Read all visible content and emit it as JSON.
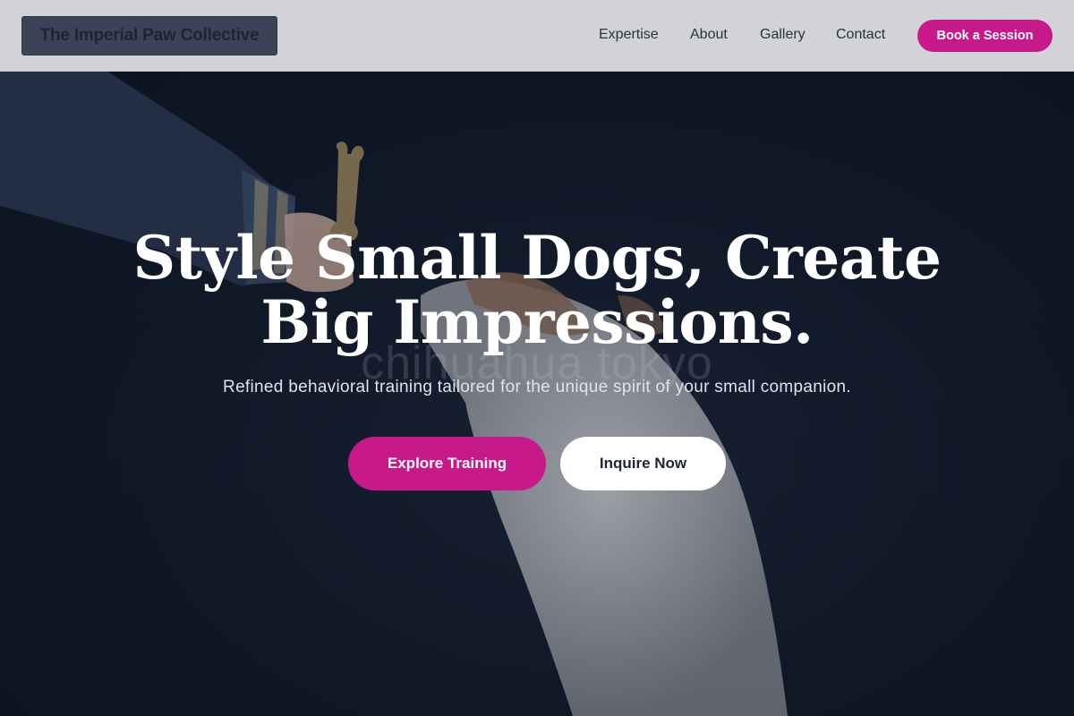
{
  "brand": {
    "name": "The Imperial Paw Collective"
  },
  "nav": {
    "links": [
      "Expertise",
      "About",
      "Gallery",
      "Contact"
    ],
    "cta": "Book a Session"
  },
  "hero": {
    "headline_line1": "Style Small Dogs, Create",
    "headline_line2": "Big Impressions.",
    "watermark": "chihuahua tokyo",
    "subheadline": "Refined behavioral training tailored for the unique spirit of your small companion.",
    "primary_button": "Explore Training",
    "secondary_button": "Inquire Now"
  },
  "colors": {
    "accent": "#c8198b",
    "nav_background": "#d1d3d7",
    "hero_background": "#0f1726",
    "brand_box": "#3b4456"
  }
}
